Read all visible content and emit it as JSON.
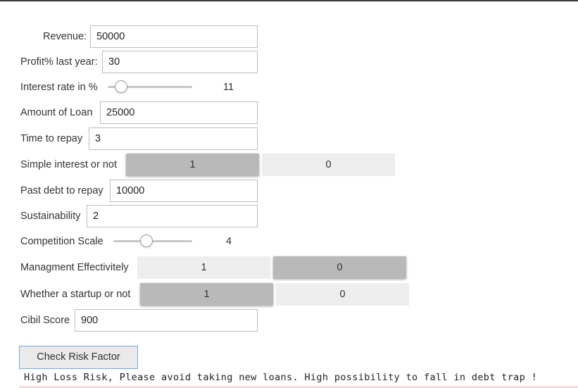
{
  "form": {
    "revenue": {
      "label": "Revenue:",
      "value": "50000"
    },
    "profit": {
      "label": "Profit% last year:",
      "value": "30"
    },
    "interest_rate": {
      "label": "Interest rate in %",
      "value": "11",
      "level": 0.1
    },
    "loan_amount": {
      "label": "Amount of Loan",
      "value": "25000"
    },
    "time_to_repay": {
      "label": "Time to repay",
      "value": "3"
    },
    "simple_interest": {
      "label": "Simple interest or not",
      "options": [
        "1",
        "0"
      ],
      "selected": "1"
    },
    "past_debt": {
      "label": "Past debt to repay",
      "value": "10000"
    },
    "sustainability": {
      "label": "Sustainability",
      "value": "2"
    },
    "competition": {
      "label": "Competition Scale",
      "value": "4",
      "level": 0.4
    },
    "management": {
      "label": "Managment Effectivitely",
      "options": [
        "1",
        "0"
      ],
      "selected": "0"
    },
    "startup": {
      "label": "Whether a startup or not",
      "options": [
        "1",
        "0"
      ],
      "selected": "1"
    },
    "cibil": {
      "label": "Cibil Score",
      "value": "900"
    }
  },
  "actions": {
    "check_label": "Check Risk Factor"
  },
  "result": {
    "text": "High Loss Risk, Please avoid taking new loans. High possibility to fall in debt trap !"
  },
  "colors": {
    "toggle_active": "#b9b9b9",
    "toggle_inactive": "#eeeeee",
    "button_border": "#7aa7d6",
    "result_underline": "#f9dbe2"
  }
}
